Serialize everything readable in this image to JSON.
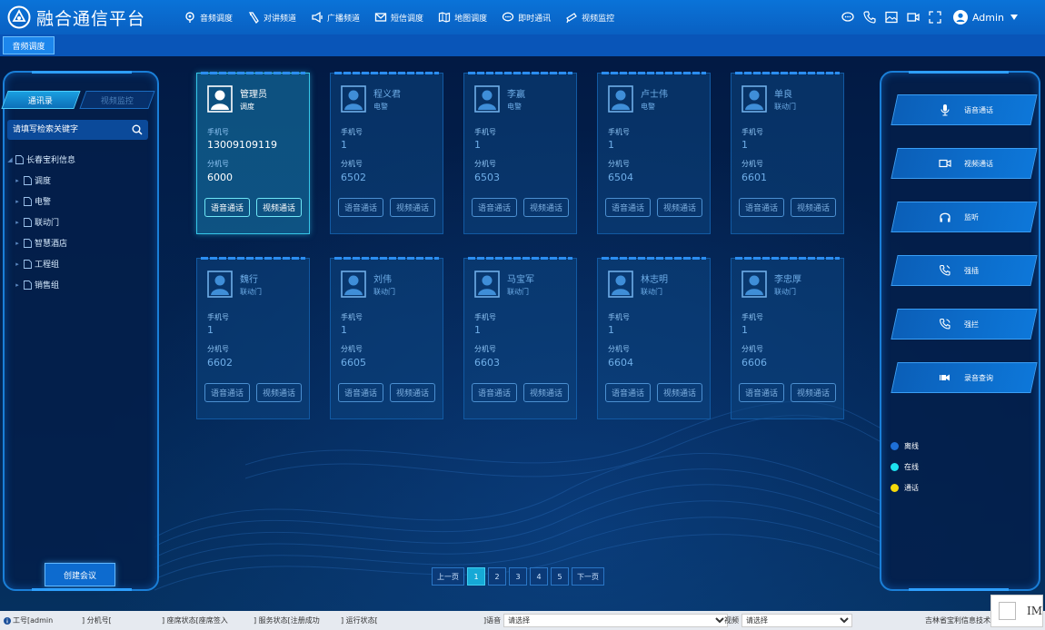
{
  "app": {
    "title": "融合通信平台"
  },
  "nav": [
    {
      "label": "音频调度",
      "icon": "audio-dispatch-icon"
    },
    {
      "label": "对讲频道",
      "icon": "intercom-icon"
    },
    {
      "label": "广播频道",
      "icon": "broadcast-icon"
    },
    {
      "label": "短信调度",
      "icon": "sms-icon"
    },
    {
      "label": "地图调度",
      "icon": "map-icon"
    },
    {
      "label": "即时通讯",
      "icon": "chat-icon"
    },
    {
      "label": "视频监控",
      "icon": "video-monitor-icon"
    }
  ],
  "user": {
    "name": "Admin"
  },
  "page_tab": "音频调度",
  "left": {
    "tabs": [
      "通讯录",
      "视频监控"
    ],
    "search_placeholder": "请填写检索关键字",
    "tree_root": "长春宝利信息",
    "tree_children": [
      "调度",
      "电警",
      "联动门",
      "智慧酒店",
      "工程组",
      "销售组"
    ],
    "create_button": "创建会议"
  },
  "card_labels": {
    "phone": "手机号",
    "ext": "分机号",
    "voice_btn": "语音通话",
    "video_btn": "视频通话"
  },
  "cards": [
    {
      "name": "管理员",
      "dept": "调度",
      "phone": "13009109119",
      "ext": "6000",
      "state": "active"
    },
    {
      "name": "程义君",
      "dept": "电警",
      "phone": "1",
      "ext": "6502",
      "state": "dim"
    },
    {
      "name": "李赢",
      "dept": "电警",
      "phone": "1",
      "ext": "6503",
      "state": "dim"
    },
    {
      "name": "卢士伟",
      "dept": "电警",
      "phone": "1",
      "ext": "6504",
      "state": "dim"
    },
    {
      "name": "单良",
      "dept": "联动门",
      "phone": "1",
      "ext": "6601",
      "state": "dim"
    },
    {
      "name": "魏行",
      "dept": "联动门",
      "phone": "1",
      "ext": "6602",
      "state": "dim"
    },
    {
      "name": "刘伟",
      "dept": "联动门",
      "phone": "1",
      "ext": "6605",
      "state": "dim"
    },
    {
      "name": "马宝军",
      "dept": "联动门",
      "phone": "1",
      "ext": "6603",
      "state": "dim"
    },
    {
      "name": "林志明",
      "dept": "联动门",
      "phone": "1",
      "ext": "6604",
      "state": "dim"
    },
    {
      "name": "李忠厚",
      "dept": "联动门",
      "phone": "1",
      "ext": "6606",
      "state": "dim"
    }
  ],
  "pager": {
    "prev": "上一页",
    "pages": [
      "1",
      "2",
      "3",
      "4",
      "5"
    ],
    "next": "下一页",
    "current": "1"
  },
  "actions": [
    {
      "label": "语音通话",
      "icon": "microphone-icon"
    },
    {
      "label": "视频通话",
      "icon": "video-camera-icon"
    },
    {
      "label": "监听",
      "icon": "headphones-icon"
    },
    {
      "label": "强插",
      "icon": "phone-insert-icon"
    },
    {
      "label": "强拦",
      "icon": "phone-intercept-icon"
    },
    {
      "label": "录音查询",
      "icon": "recording-icon"
    }
  ],
  "legend": [
    {
      "label": "离线",
      "color": "#1e6fd6"
    },
    {
      "label": "在线",
      "color": "#1de2f0"
    },
    {
      "label": "通话",
      "color": "#f5d90a"
    }
  ],
  "status": {
    "workid": "工号[admin",
    "ext": "] 分机号[",
    "seat": "] 座席状态[座席签入",
    "service": "] 服务状态[注册成功",
    "run": "] 运行状态[",
    "voice_label": "]语音",
    "voice_select": "请选择",
    "video_label": "视频",
    "video_select": "请选择",
    "company": "吉林省宝利信息技术有"
  },
  "im_label": "IM",
  "colors": {
    "accent": "#0a73d8",
    "panel_border": "#1a7fd8",
    "active_card": "#36c6e8"
  }
}
